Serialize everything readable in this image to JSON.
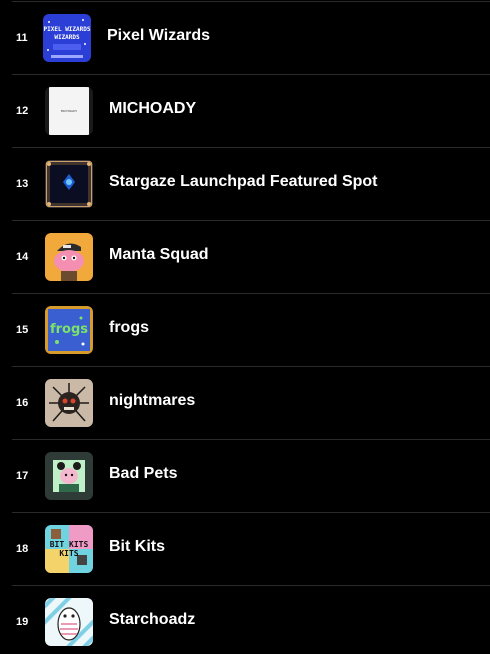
{
  "collections": [
    {
      "rank": "11",
      "name": "Pixel Wizards",
      "thumb_icon": "pixel-wizards-thumbnail",
      "thumb_text": "PIXEL WIZARDS"
    },
    {
      "rank": "12",
      "name": "MICHOADY",
      "thumb_icon": "michoady-thumbnail",
      "thumb_text": "MICHOADY"
    },
    {
      "rank": "13",
      "name": "Stargaze Launchpad Featured Spot",
      "thumb_icon": "stargaze-launchpad-thumbnail"
    },
    {
      "rank": "14",
      "name": "Manta Squad",
      "thumb_icon": "manta-squad-thumbnail"
    },
    {
      "rank": "15",
      "name": "frogs",
      "thumb_icon": "frogs-thumbnail",
      "thumb_text": "frogs"
    },
    {
      "rank": "16",
      "name": "nightmares",
      "thumb_icon": "nightmares-thumbnail"
    },
    {
      "rank": "17",
      "name": "Bad Pets",
      "thumb_icon": "bad-pets-thumbnail"
    },
    {
      "rank": "18",
      "name": "Bit Kits",
      "thumb_icon": "bit-kits-thumbnail",
      "thumb_text": "BIT KITS"
    },
    {
      "rank": "19",
      "name": "Starchoadz",
      "thumb_icon": "starchoadz-thumbnail"
    }
  ],
  "colors": {
    "background": "#000000",
    "divider": "#2a2a2a",
    "text": "#ffffff"
  }
}
